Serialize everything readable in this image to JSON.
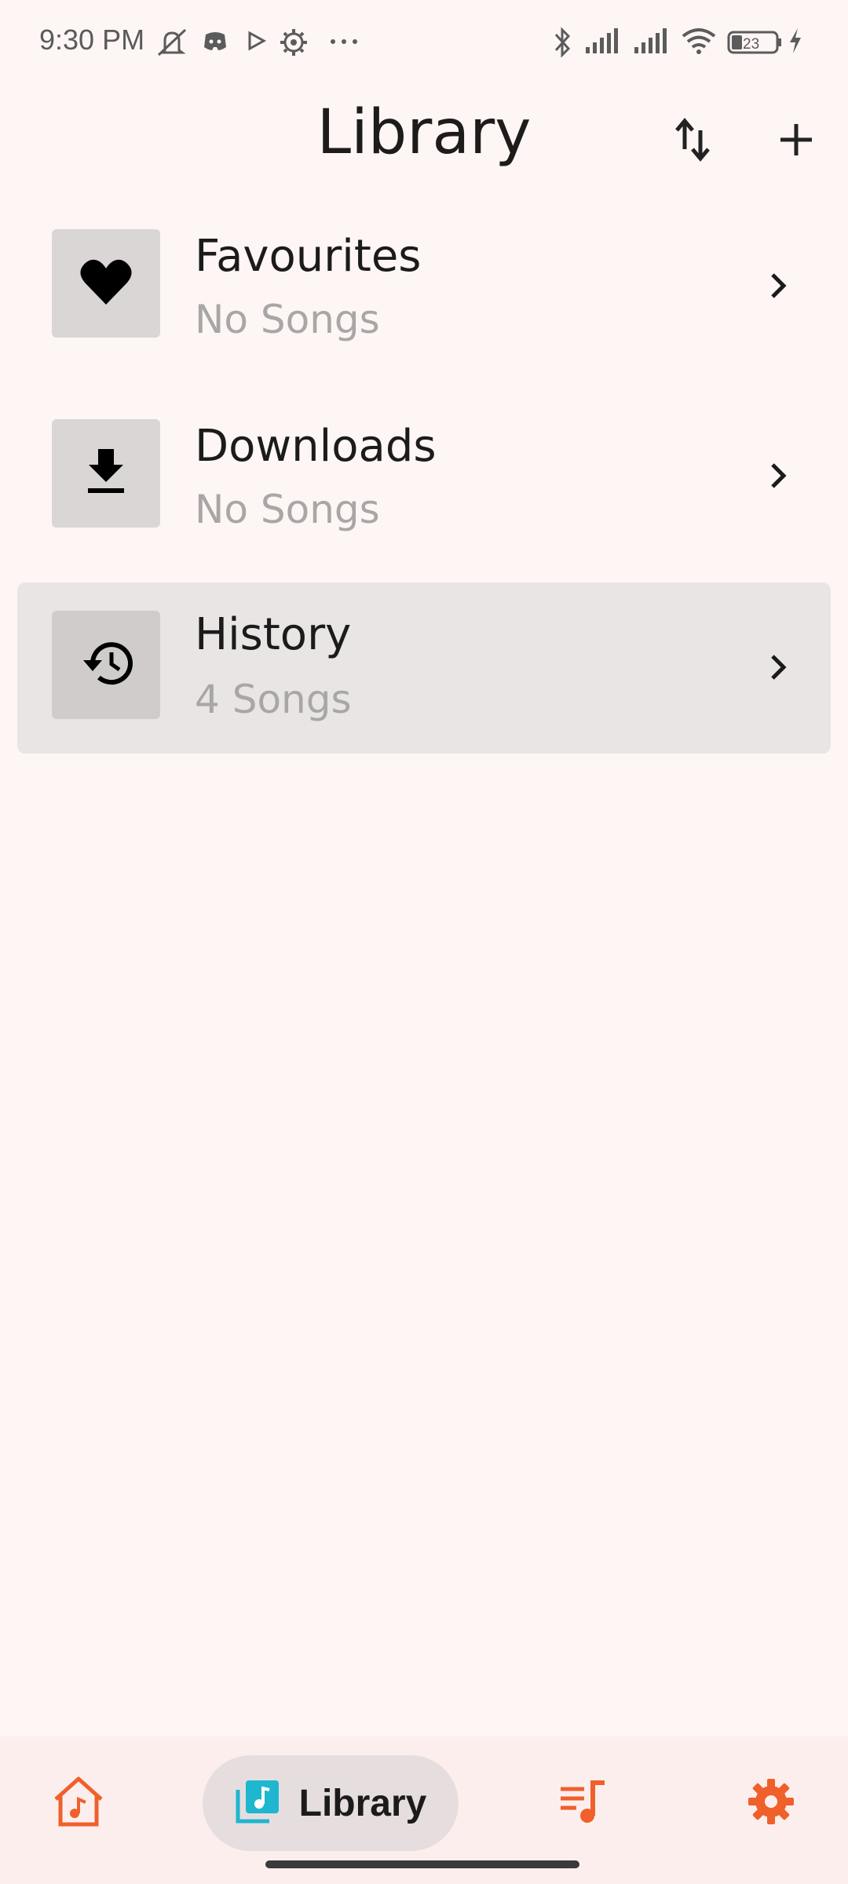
{
  "status_bar": {
    "time": "9:30 PM",
    "battery": "23",
    "icons": [
      "mute-icon",
      "discord-icon",
      "play-store-icon",
      "settings-cog-icon",
      "more-dots-icon",
      "bluetooth-icon",
      "signal-icon",
      "signal-icon",
      "wifi-icon",
      "battery-icon",
      "charging-icon"
    ]
  },
  "header": {
    "title": "Library",
    "sort_icon": "sort-icon",
    "add_icon": "add-icon"
  },
  "list": {
    "items": [
      {
        "title": "Favourites",
        "subtitle": "No Songs",
        "icon": "heart-icon",
        "selected": false
      },
      {
        "title": "Downloads",
        "subtitle": "No Songs",
        "icon": "download-icon",
        "selected": false
      },
      {
        "title": "History",
        "subtitle": "4 Songs",
        "icon": "history-icon",
        "selected": true
      }
    ]
  },
  "bottom_nav": {
    "items": [
      {
        "label": "",
        "icon": "home-music-icon"
      },
      {
        "label": "Library",
        "icon": "library-music-icon",
        "active": true
      },
      {
        "label": "",
        "icon": "queue-music-icon"
      },
      {
        "label": "",
        "icon": "settings-icon"
      }
    ]
  },
  "colors": {
    "background": "#fdf6f5",
    "accent": "#f0602a",
    "library_icon": "#1fb6d0",
    "selected_row": "#e8e5e4",
    "subtitle": "#a9a6a6"
  }
}
